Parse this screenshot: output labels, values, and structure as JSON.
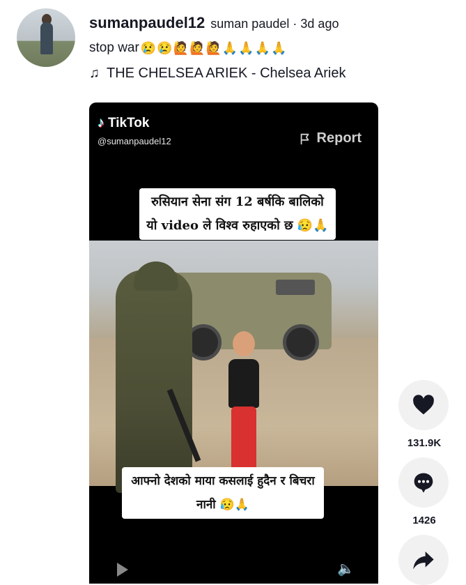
{
  "post": {
    "username": "sumanpaudel12",
    "nickname": "suman paudel",
    "separator": "·",
    "time": "3d ago",
    "description_text": "stop war",
    "description_emojis": "😢😢🙋🙋🙋🙏🙏🙏🙏",
    "music_icon": "♫",
    "music_title": "THE CHELSEA ARIEK - Chelsea Ariek"
  },
  "video": {
    "brand": "TikTok",
    "brand_icon": "♪",
    "handle": "@sumanpaudel12",
    "report_label": "Report",
    "caption_top": "रुसियान सेना संग 12 बर्षकि बालिको यो video ले विश्व रुहाएको छ 😥🙏",
    "caption_bottom": "आफ्नो देशको माया कसलाई हुदैन र बिचरा नानी 😥🙏",
    "volume_icon": "🔈"
  },
  "actions": {
    "like_count": "131.9K",
    "comment_count": "1426",
    "like_icon": "heart-icon",
    "comment_icon": "comment-icon",
    "share_icon": "share-icon"
  },
  "colors": {
    "text": "#161823",
    "action_bg": "#f1f1f2",
    "video_bg": "#000000"
  }
}
